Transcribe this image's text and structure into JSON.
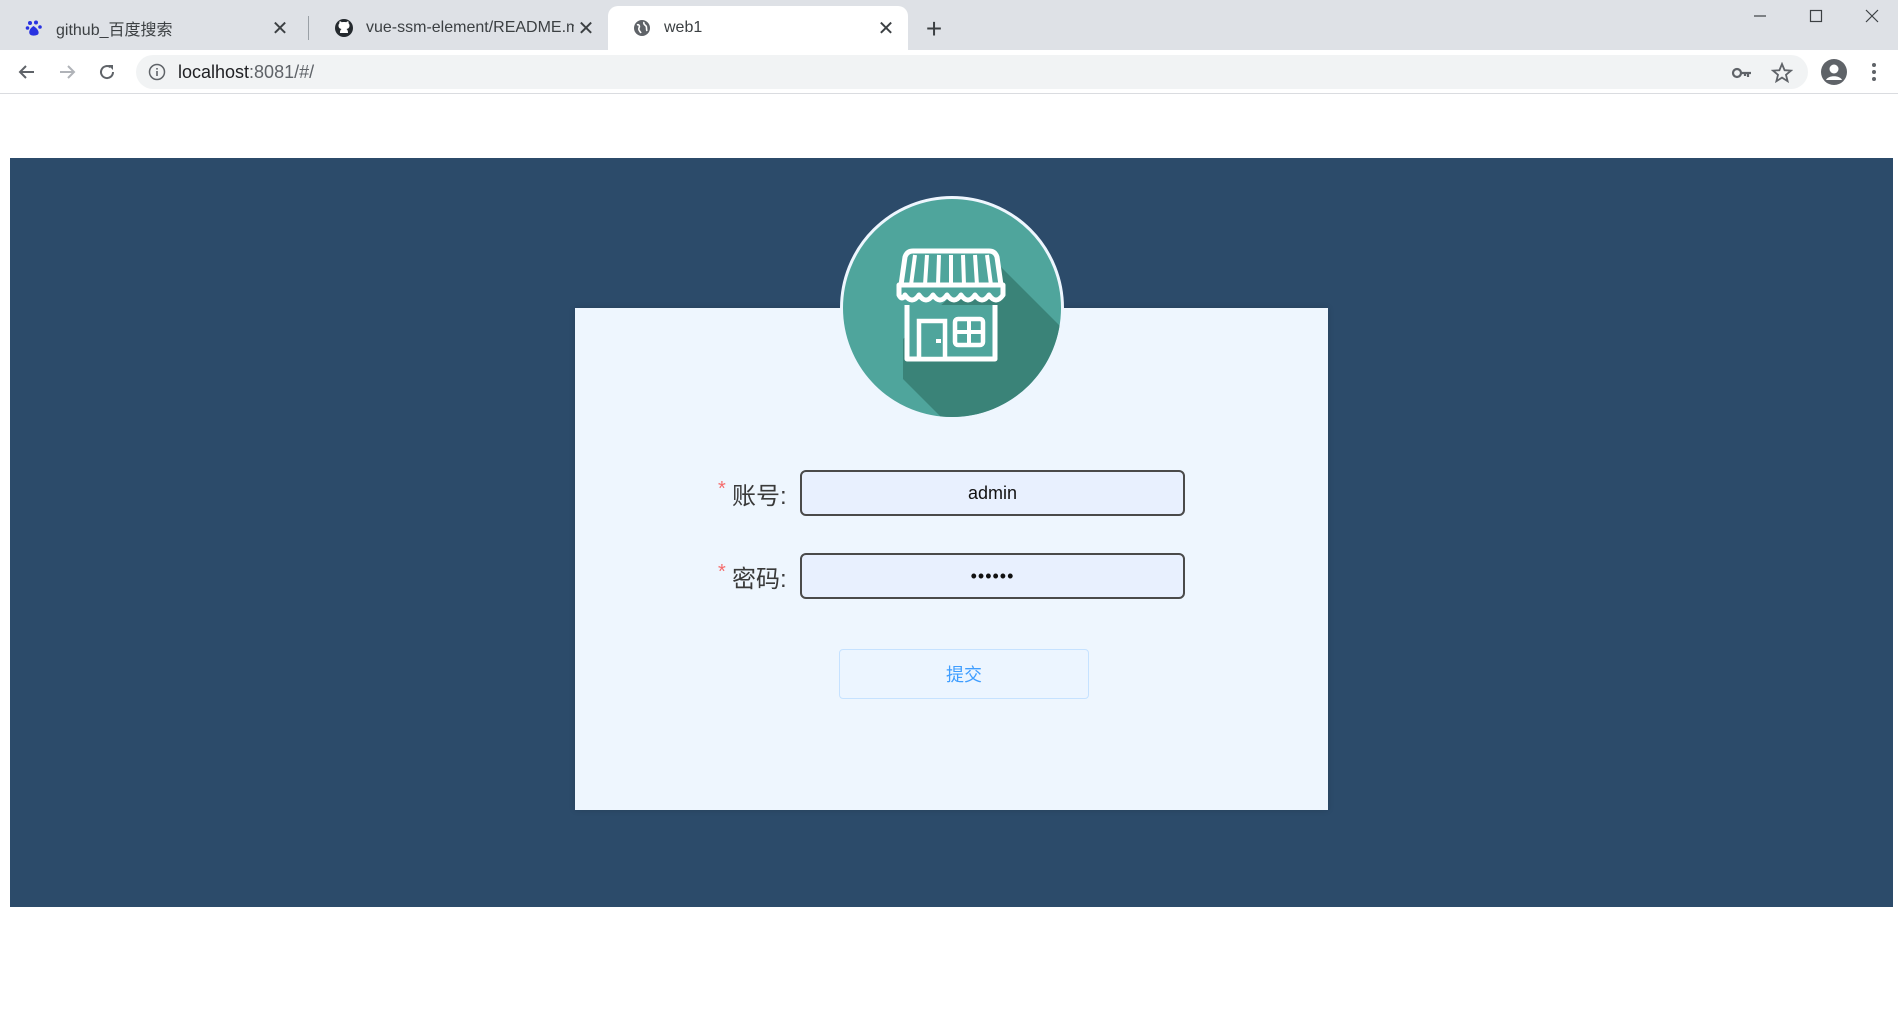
{
  "browser": {
    "tabs": [
      {
        "title": "github_百度搜索",
        "icon": "baidu-paw-icon",
        "active": false
      },
      {
        "title": "vue-ssm-element/README.md",
        "icon": "github-icon",
        "active": false
      },
      {
        "title": "web1",
        "icon": "globe-icon",
        "active": true
      }
    ],
    "new_tab": "+",
    "address": {
      "host": "localhost",
      "rest": ":8081/#/"
    }
  },
  "login": {
    "logo_icon": "storefront-icon",
    "colors": {
      "background": "#2c4b6a",
      "card": "#eef6fe",
      "logo": "#4fa59c",
      "required": "#f56c6c",
      "button_text": "#409eff"
    },
    "account": {
      "required_mark": "*",
      "label": "账号:",
      "value": "admin"
    },
    "password": {
      "required_mark": "*",
      "label": "密码:",
      "value": "••••••"
    },
    "submit_label": "提交"
  }
}
